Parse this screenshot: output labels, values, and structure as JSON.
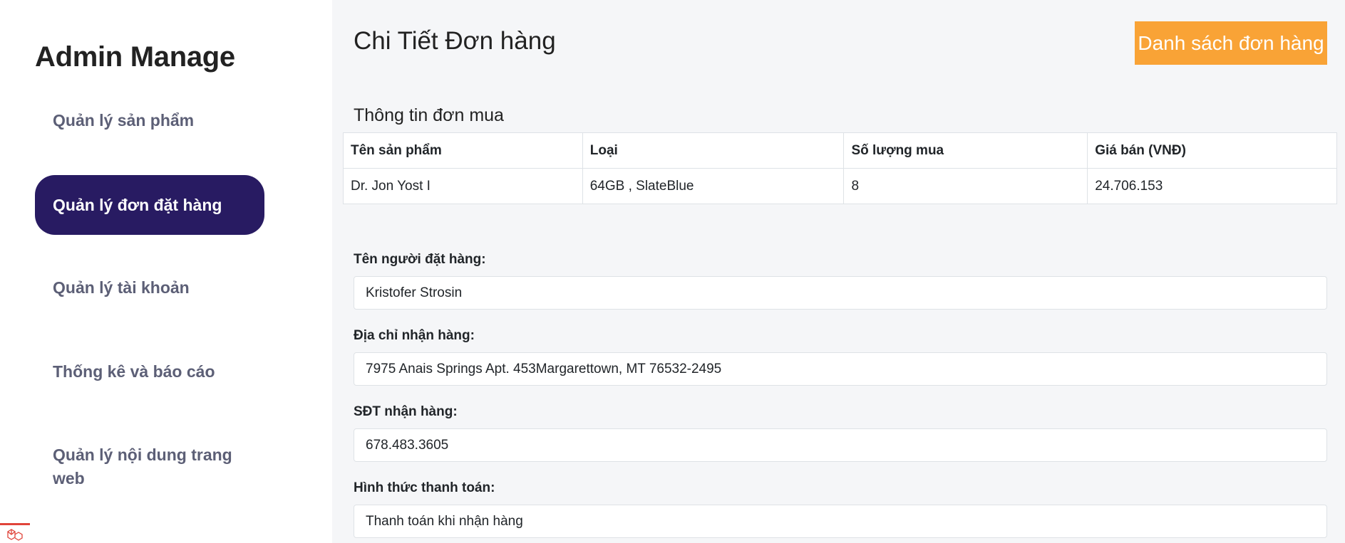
{
  "sidebar": {
    "brand": "Admin Manage",
    "items": [
      {
        "label": "Quản lý sản phẩm",
        "active": false
      },
      {
        "label": "Quản lý đơn đặt hàng",
        "active": true
      },
      {
        "label": "Quản lý tài khoản",
        "active": false
      },
      {
        "label": "Thống kê và báo cáo",
        "active": false
      },
      {
        "label": "Quản lý nội dung trang web",
        "active": false
      }
    ]
  },
  "header": {
    "title": "Chi Tiết Đơn hàng",
    "list_button_label": "Danh sách đơn hàng"
  },
  "order_section": {
    "title": "Thông tin đơn mua",
    "columns": [
      "Tên sản phẩm",
      "Loại",
      "Số lượng mua",
      "Giá bán (VNĐ)"
    ],
    "rows": [
      [
        "Dr. Jon Yost I",
        "64GB , SlateBlue",
        "8",
        "24.706.153"
      ]
    ]
  },
  "form": {
    "customer_name": {
      "label": "Tên người đặt hàng:",
      "value": "Kristofer Strosin"
    },
    "address": {
      "label": "Địa chỉ nhận hàng:",
      "value": "7975 Anais Springs Apt. 453Margarettown, MT 76532-2495"
    },
    "phone": {
      "label": "SĐT nhận hàng:",
      "value": "678.483.3605"
    },
    "payment": {
      "label": "Hình thức thanh toán:",
      "value": "Thanh toán khi nhận hàng"
    }
  },
  "colors": {
    "sidebar_active": "#281b62",
    "accent_button": "#f9a336",
    "nav_text": "#5c5f76"
  },
  "icons": {
    "debug_bar": "laravel-logo-icon"
  }
}
